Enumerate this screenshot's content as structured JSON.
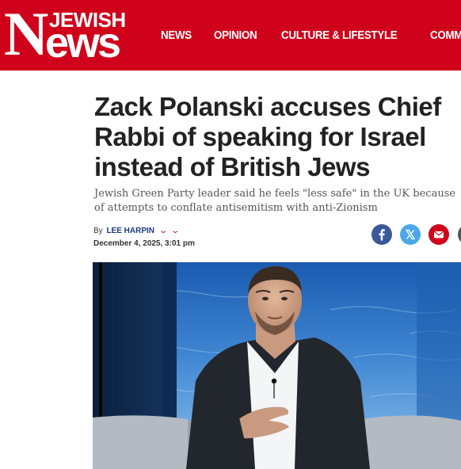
{
  "site": {
    "logo_n": "N",
    "logo_top": "JEWISH",
    "logo_bottom": "ews"
  },
  "nav": {
    "items": [
      "NEWS",
      "OPINION",
      "CULTURE & LIFESTYLE",
      "COMMUNIT"
    ]
  },
  "article": {
    "headline": "Zack Polanski accuses Chief Rabbi of speaking for Israel instead of British Jews",
    "subheadline": "Jewish Green Party leader said he feels \"less safe\" in the UK because of attempts to conflate antisemitism with anti-Zionism",
    "by_prefix": "By",
    "author": "LEE HARPIN",
    "date": "December 4, 2025, 3:01 pm"
  },
  "share": {
    "icons": [
      "facebook-icon",
      "x-icon",
      "email-icon",
      "more-icon"
    ]
  },
  "colors": {
    "brand_red": "#d0021b",
    "facebook": "#3b5998",
    "twitter": "#4aa8e8",
    "author_blue": "#1a3a7a"
  }
}
